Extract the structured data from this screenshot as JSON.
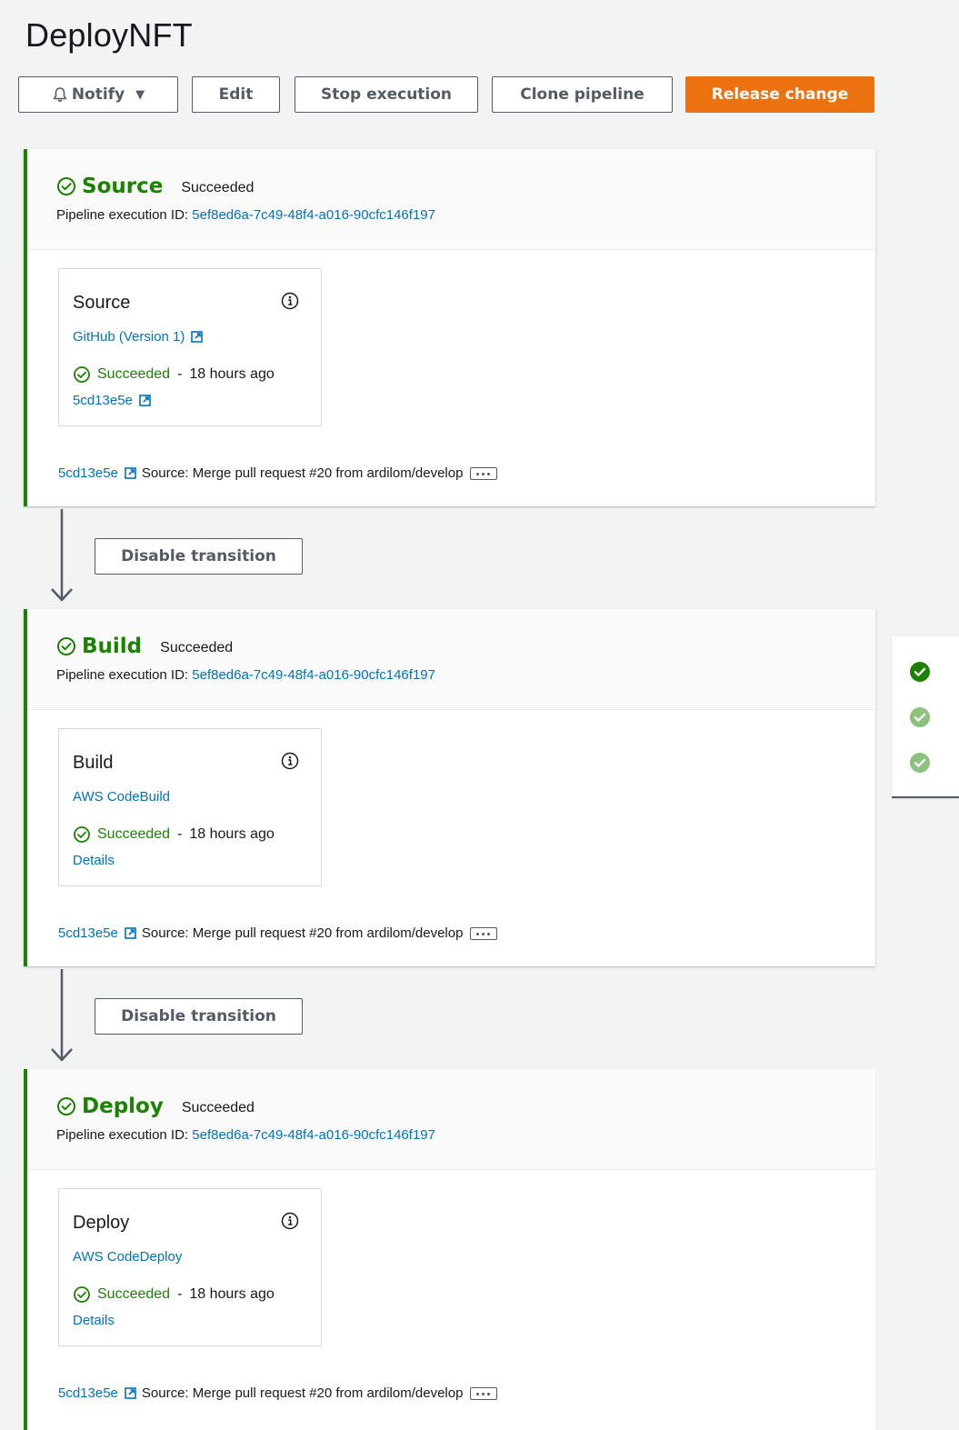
{
  "page": {
    "title": "DeployNFT"
  },
  "toolbar": {
    "notify_label": "Notify",
    "edit_label": "Edit",
    "stop_label": "Stop execution",
    "clone_label": "Clone pipeline",
    "release_label": "Release change"
  },
  "common": {
    "exec_label": "Pipeline execution ID:",
    "exec_id": "5ef8ed6a-7c49-48f4-a016-90cfc146f197",
    "succeeded": "Succeeded",
    "dash": "-",
    "time_ago": "18 hours ago",
    "commit_id": "5cd13e5e",
    "commit_msg": "Source: Merge pull request #20 from ardilom/develop"
  },
  "stages": [
    {
      "name": "Source",
      "status": "Succeeded",
      "action": {
        "name": "Source",
        "provider": "GitHub (Version 1)",
        "link": "5cd13e5e"
      }
    },
    {
      "name": "Build",
      "status": "Succeeded",
      "action": {
        "name": "Build",
        "provider": "AWS CodeBuild",
        "link": "Details"
      }
    },
    {
      "name": "Deploy",
      "status": "Succeeded",
      "action": {
        "name": "Deploy",
        "provider": "AWS CodeDeploy",
        "link": "Details"
      }
    }
  ],
  "transitions": [
    {
      "label": "Disable transition"
    },
    {
      "label": "Disable transition"
    }
  ],
  "colors": {
    "success": "#1d8102",
    "link": "#0073bb",
    "primary": "#ec7211",
    "success_light": "#8cc27d"
  },
  "icons": {
    "notify": "bell-icon",
    "caret": "caret-down-icon",
    "status": "check-circle-icon",
    "info": "info-icon",
    "external": "external-link-icon",
    "more": "ellipsis-icon",
    "arrow": "arrow-down-icon"
  }
}
